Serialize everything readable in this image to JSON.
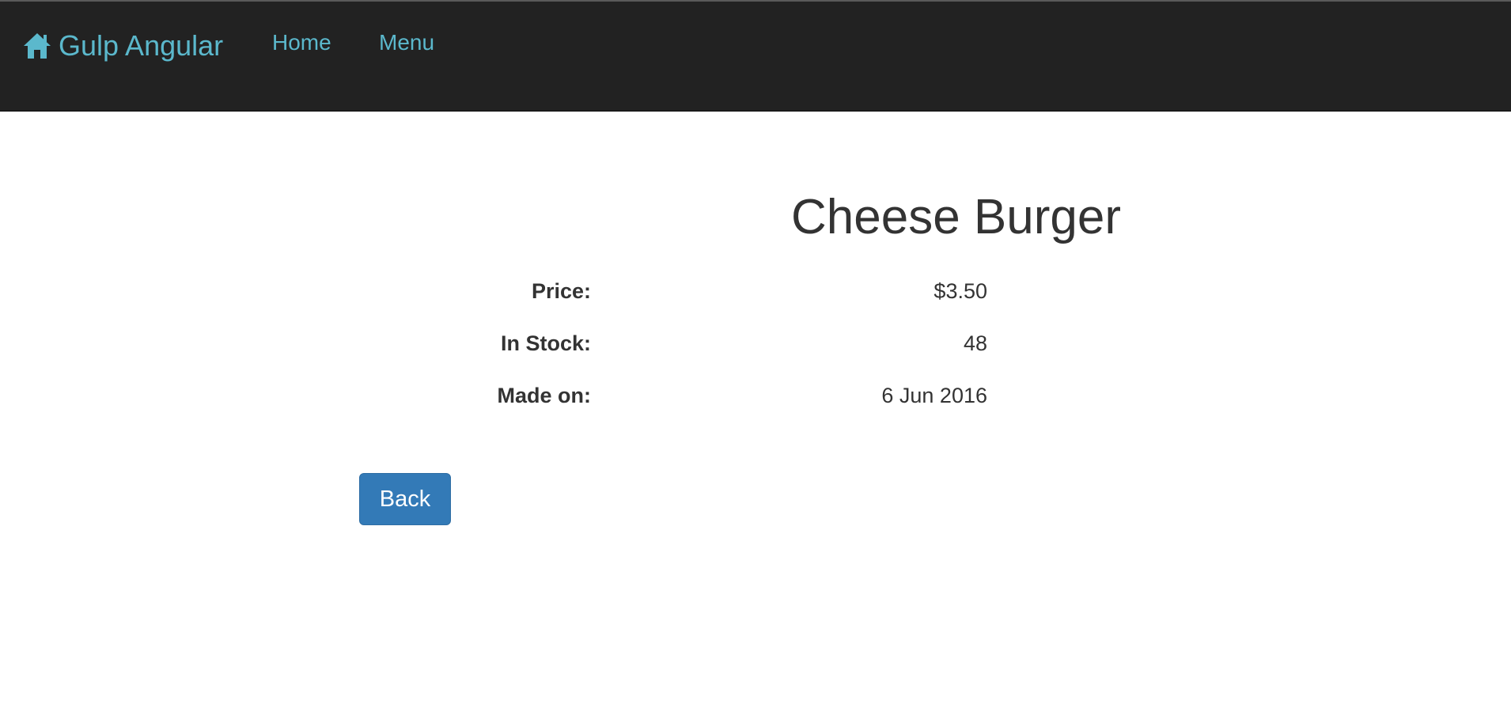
{
  "navbar": {
    "brand_label": "Gulp Angular",
    "brand_icon": "home-icon",
    "links": [
      {
        "label": "Home"
      },
      {
        "label": "Menu"
      }
    ],
    "background_color": "#222222",
    "link_color": "#5bb8cc"
  },
  "product": {
    "title": "Cheese Burger",
    "details": [
      {
        "label": "Price:",
        "value": "$3.50"
      },
      {
        "label": "In Stock:",
        "value": "48"
      },
      {
        "label": "Made on:",
        "value": "6 Jun 2016"
      }
    ]
  },
  "actions": {
    "back_label": "Back",
    "button_color": "#337ab7"
  }
}
